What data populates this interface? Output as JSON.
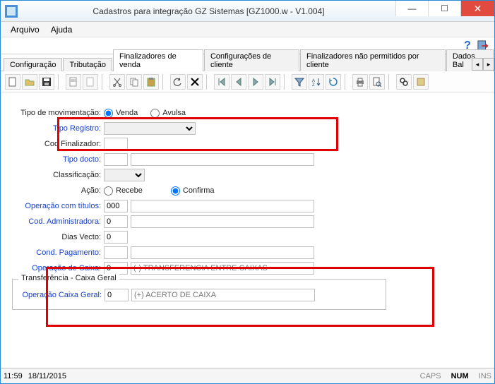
{
  "window": {
    "title": "Cadastros para integração GZ Sistemas [GZ1000.w - V1.004]"
  },
  "menu": {
    "arquivo": "Arquivo",
    "ajuda": "Ajuda"
  },
  "help": {
    "question": "?"
  },
  "tabs": {
    "configuracao": "Configuração",
    "tributacao": "Tributação",
    "finalizadores": "Finalizadores de venda",
    "config_cliente": "Configurações de cliente",
    "fin_nao_perm": "Finalizadores não permitidos por cliente",
    "dados_bal": "Dados Bal"
  },
  "form": {
    "tipo_mov_label": "Tipo de movimentação:",
    "venda": "Venda",
    "avulsa": "Avulsa",
    "tipo_registro_label": "Tipo Registro:",
    "tipo_registro_value": "",
    "cod_finalizador_label": "Cod Finalizador:",
    "cod_finalizador_value": "",
    "tipo_docto_label": "Tipo docto:",
    "tipo_docto_value": "",
    "tipo_docto_desc": "",
    "classificacao_label": "Classificação:",
    "acao_label": "Ação:",
    "recebe": "Recebe",
    "confirma": "Confirma",
    "op_titulos_label": "Operação com títulos:",
    "op_titulos_value": "000",
    "op_titulos_desc": "",
    "cod_adm_label": "Cod. Administradora:",
    "cod_adm_value": "0",
    "cod_adm_desc": "",
    "dias_vecto_label": "Dias Vecto:",
    "dias_vecto_value": "0",
    "cond_pag_label": "Cond. Pagamento:",
    "cond_pag_value": "",
    "cond_pag_desc": "",
    "op_caixa_label": "Operação de Caixa:",
    "op_caixa_value": "0",
    "op_caixa_desc": "(-) TRANSFERENCIA ENTRE CAIXAS",
    "transf_legend": "Transferência - Caixa Geral",
    "op_caixa_geral_label": "Operação Caixa Geral:",
    "op_caixa_geral_value": "0",
    "op_caixa_geral_desc": "(+) ACERTO DE CAIXA"
  },
  "status": {
    "time": "11:59",
    "date": "18/11/2015",
    "caps": "CAPS",
    "num": "NUM",
    "ins": "INS"
  }
}
